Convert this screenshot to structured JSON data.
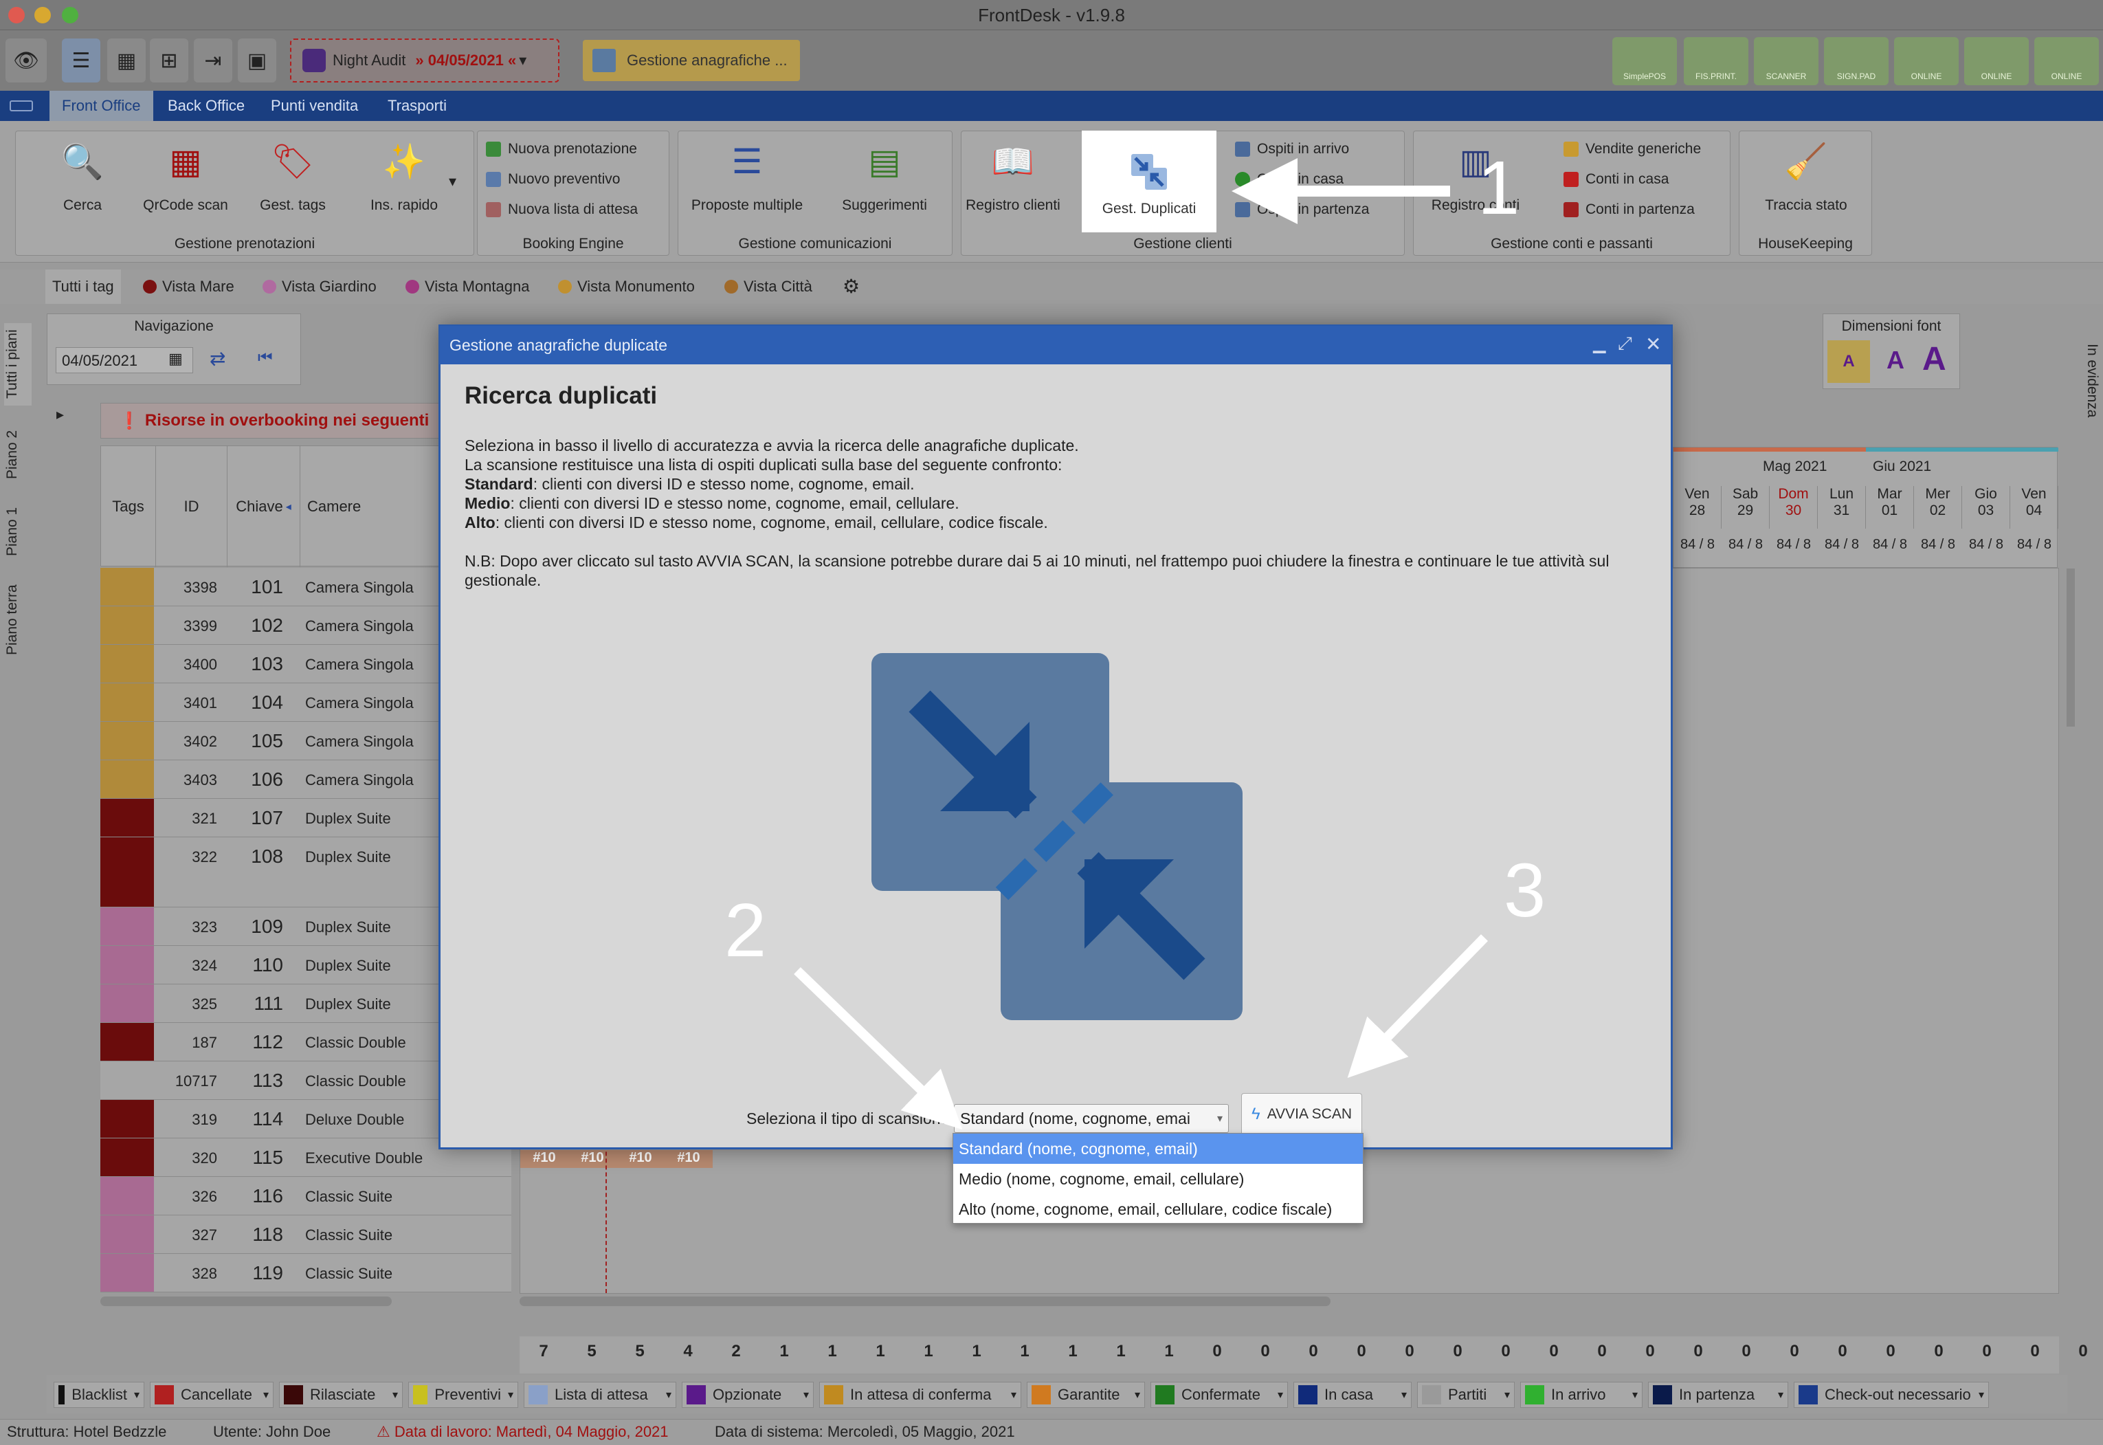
{
  "window": {
    "title": "FrontDesk - v1.9.8"
  },
  "toolbar": {
    "night_audit_label": "Night Audit",
    "night_audit_date": "» 04/05/2021 «",
    "gest_chip": "Gestione anagrafiche ...",
    "right_buttons": [
      "SimplePOS",
      "FIS.PRINT.",
      "SCANNER",
      "SIGN.PAD",
      "ONLINE",
      "ONLINE",
      "ONLINE"
    ]
  },
  "menu": {
    "tabs": [
      "Front Office",
      "Back Office",
      "Punti vendita",
      "Trasporti"
    ]
  },
  "ribbon": {
    "g1": {
      "label": "Gestione prenotazioni",
      "buttons": [
        "Cerca",
        "QrCode scan",
        "Gest. tags",
        "Ins. rapido"
      ]
    },
    "g2": {
      "label": "Booking Engine",
      "items": [
        "Nuova prenotazione",
        "Nuovo preventivo",
        "Nuova lista di attesa"
      ]
    },
    "g3": {
      "label": "Gestione comunicazioni",
      "buttons": [
        "Proposte multiple",
        "Suggerimenti"
      ]
    },
    "g4": {
      "label": "Gestione clienti",
      "buttons": [
        "Registro clienti",
        "Gest. Duplicati"
      ],
      "items": [
        "Ospiti in arrivo",
        "Ospiti in casa",
        "Ospiti in partenza"
      ]
    },
    "g5": {
      "label": "Gestione conti e passanti",
      "buttons": [
        "Registro conti"
      ],
      "items": [
        "Vendite generiche",
        "Conti in casa",
        "Conti in partenza"
      ]
    },
    "g6": {
      "label": "HouseKeeping",
      "buttons": [
        "Traccia stato"
      ]
    }
  },
  "tags": {
    "all": "Tutti i tag",
    "items": [
      {
        "label": "Vista Mare",
        "color": "#7a1010"
      },
      {
        "label": "Vista Giardino",
        "color": "#b06aa0"
      },
      {
        "label": "Vista Montagna",
        "color": "#a03880"
      },
      {
        "label": "Vista Monumento",
        "color": "#c09030"
      },
      {
        "label": "Vista Città",
        "color": "#a06a2a"
      }
    ]
  },
  "side_tabs": [
    "Tutti i piani",
    "Piano 2",
    "Piano 1",
    "Piano terra"
  ],
  "right_side_tab": "In evidenza",
  "nav": {
    "title": "Navigazione",
    "date": "04/05/2021"
  },
  "font_sizes": {
    "title": "Dimensioni font",
    "a": "A"
  },
  "overbooking": "Risorse in overbooking nei seguenti",
  "table": {
    "headers": {
      "tags": "Tags",
      "id": "ID",
      "key": "Chiave",
      "rooms": "Camere"
    },
    "rows": [
      {
        "id": "3398",
        "key": "101",
        "room": "Camera Singola",
        "color": "#b08a3a"
      },
      {
        "id": "3399",
        "key": "102",
        "room": "Camera Singola",
        "color": "#b08a3a"
      },
      {
        "id": "3400",
        "key": "103",
        "room": "Camera Singola",
        "color": "#b08a3a"
      },
      {
        "id": "3401",
        "key": "104",
        "room": "Camera Singola",
        "color": "#b08a3a"
      },
      {
        "id": "3402",
        "key": "105",
        "room": "Camera Singola",
        "color": "#b08a3a"
      },
      {
        "id": "3403",
        "key": "106",
        "room": "Camera Singola",
        "color": "#b08a3a"
      },
      {
        "id": "321",
        "key": "107",
        "room": "Duplex Suite",
        "color": "#6a0c0c"
      },
      {
        "id": "322",
        "key": "108",
        "room": "Duplex Suite",
        "color": "#6a0c0c"
      },
      {
        "id": "323",
        "key": "109",
        "room": "Duplex Suite",
        "color": "#a86a92"
      },
      {
        "id": "324",
        "key": "110",
        "room": "Duplex Suite",
        "color": "#a86a92"
      },
      {
        "id": "325",
        "key": "111",
        "room": "Duplex Suite",
        "color": "#a86a92"
      },
      {
        "id": "187",
        "key": "112",
        "room": "Classic Double",
        "color": "#6a0c0c"
      },
      {
        "id": "10717",
        "key": "113",
        "room": "Classic Double",
        "color": "#a6a6a6"
      },
      {
        "id": "319",
        "key": "114",
        "room": "Deluxe Double",
        "color": "#6a0c0c"
      },
      {
        "id": "320",
        "key": "115",
        "room": "Executive Double",
        "color": "#6a0c0c"
      },
      {
        "id": "326",
        "key": "116",
        "room": "Classic Suite",
        "color": "#a86a92"
      },
      {
        "id": "327",
        "key": "118",
        "room": "Classic Suite",
        "color": "#a86a92"
      },
      {
        "id": "328",
        "key": "119",
        "room": "Classic Suite",
        "color": "#a86a92"
      }
    ]
  },
  "calendar": {
    "months": [
      "Mag 2021",
      "Giu 2021"
    ],
    "days": [
      {
        "w": "Ven",
        "d": "28"
      },
      {
        "w": "Sab",
        "d": "29"
      },
      {
        "w": "Dom",
        "d": "30"
      },
      {
        "w": "Lun",
        "d": "31"
      },
      {
        "w": "Mar",
        "d": "01"
      },
      {
        "w": "Mer",
        "d": "02"
      },
      {
        "w": "Gio",
        "d": "03"
      },
      {
        "w": "Ven",
        "d": "04"
      }
    ],
    "avail": "84 / 8",
    "booking_marks": [
      "#10",
      "#10",
      "#10",
      "#10"
    ],
    "counts": [
      "7",
      "5",
      "5",
      "4",
      "2",
      "1",
      "1",
      "1",
      "1",
      "1",
      "1",
      "1",
      "1",
      "1",
      "0",
      "0",
      "0",
      "0",
      "0",
      "0",
      "0",
      "0",
      "0",
      "0",
      "0",
      "0",
      "0",
      "0",
      "0",
      "0",
      "0",
      "0",
      "0"
    ]
  },
  "legend": [
    {
      "label": "Blacklist",
      "color": "#111111"
    },
    {
      "label": "Cancellate",
      "color": "#b02020"
    },
    {
      "label": "Rilasciate",
      "color": "#3a0808"
    },
    {
      "label": "Preventivi",
      "color": "#c8c020"
    },
    {
      "label": "Lista di attesa",
      "color": "#8aa0c8"
    },
    {
      "label": "Opzionate",
      "color": "#5a1a8a"
    },
    {
      "label": "In attesa di conferma",
      "color": "#c08a20"
    },
    {
      "label": "Garantite",
      "color": "#d07a20"
    },
    {
      "label": "Confermate",
      "color": "#207a20"
    },
    {
      "label": "In casa",
      "color": "#102a7a"
    },
    {
      "label": "Partiti",
      "color": "#9a9a9a"
    },
    {
      "label": "In arrivo",
      "color": "#30b030"
    },
    {
      "label": "In partenza",
      "color": "#0a1a4a"
    },
    {
      "label": "Check-out necessario",
      "color": "#1a3a8a"
    }
  ],
  "status": {
    "structure": "Struttura: Hotel Bedzzle",
    "user": "Utente: John Doe",
    "work_date": "Data di lavoro: Martedì, 04 Maggio, 2021",
    "system_date": "Data di sistema: Mercoledì, 05 Maggio, 2021"
  },
  "modal": {
    "title": "Gestione anagrafiche duplicate",
    "heading": "Ricerca duplicati",
    "line1": "Seleziona in basso il livello di accuratezza e avvia la ricerca delle anagrafiche duplicate.",
    "line2": "La scansione restituisce una lista di ospiti duplicati sulla base del seguente confronto:",
    "standard_b": "Standard",
    "standard_t": ": clienti con diversi ID e stesso nome, cognome, email.",
    "medio_b": "Medio",
    "medio_t": ": clienti con diversi ID e stesso nome, cognome, email, cellulare.",
    "alto_b": "Alto",
    "alto_t": ": clienti con diversi ID e stesso nome, cognome, email, cellulare, codice fiscale.",
    "nb": "N.B: Dopo aver cliccato sul tasto AVVIA SCAN, la scansione potrebbe durare dai 5 ai 10 minuti, nel frattempo puoi chiudere la finestra e continuare le tue attività sul gestionale.",
    "select_label": "Seleziona il tipo di scansione:",
    "select_value": "Standard (nome, cognome, emai",
    "scan_button": "AVVIA SCAN",
    "options": [
      "Standard (nome, cognome, email)",
      "Medio (nome, cognome, email, cellulare)",
      "Alto (nome, cognome, email, cellulare, codice fiscale)"
    ]
  },
  "annotations": [
    "1",
    "2",
    "3"
  ]
}
